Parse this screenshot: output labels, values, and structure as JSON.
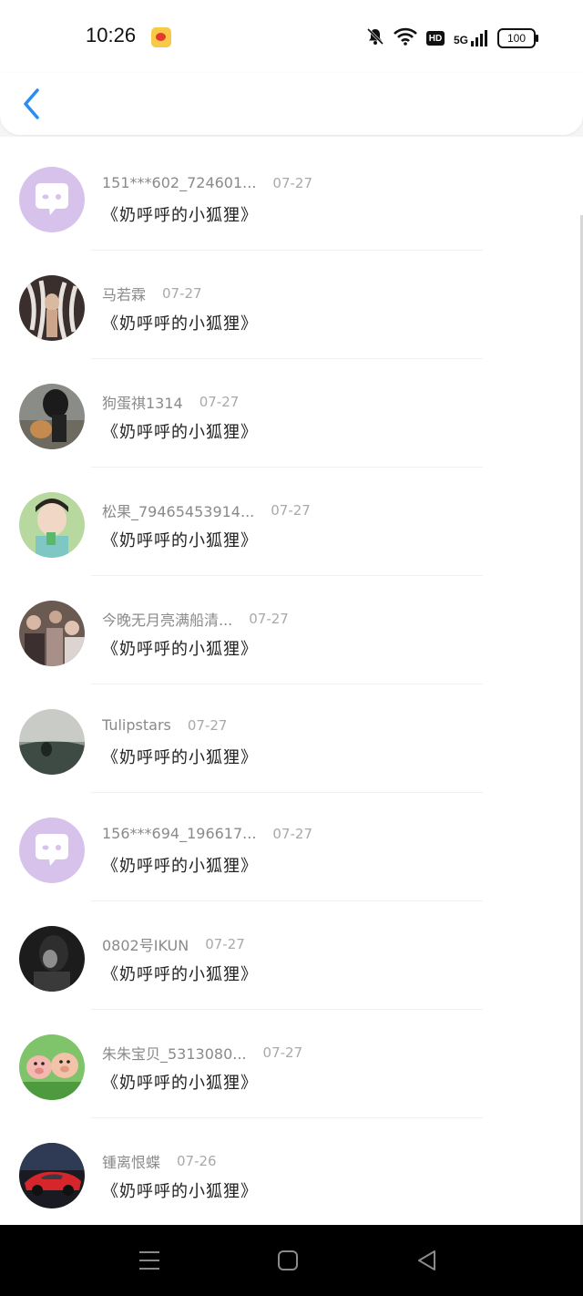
{
  "status_bar": {
    "time": "10:26",
    "battery": "100",
    "network_label": "5G",
    "hd_label": "HD"
  },
  "header": {
    "back_icon": "chevron-left-icon",
    "accent": "#2a8df2"
  },
  "entries": [
    {
      "name": "151***602_724601...",
      "date": "07-27",
      "message": "《奶呼呼的小狐狸》",
      "avatar": "placeholder"
    },
    {
      "name": "马若霖",
      "date": "07-27",
      "message": "《奶呼呼的小狐狸》",
      "avatar": "photo"
    },
    {
      "name": "狗蛋祺1314",
      "date": "07-27",
      "message": "《奶呼呼的小狐狸》",
      "avatar": "photo"
    },
    {
      "name": "松果_79465453914...",
      "date": "07-27",
      "message": "《奶呼呼的小狐狸》",
      "avatar": "photo"
    },
    {
      "name": "今晚无月亮满船清...",
      "date": "07-27",
      "message": "《奶呼呼的小狐狸》",
      "avatar": "photo"
    },
    {
      "name": "Tulipstars",
      "date": "07-27",
      "message": "《奶呼呼的小狐狸》",
      "avatar": "photo"
    },
    {
      "name": "156***694_196617...",
      "date": "07-27",
      "message": "《奶呼呼的小狐狸》",
      "avatar": "placeholder"
    },
    {
      "name": "0802号IKUN",
      "date": "07-27",
      "message": "《奶呼呼的小狐狸》",
      "avatar": "photo"
    },
    {
      "name": "朱朱宝贝_5313080...",
      "date": "07-27",
      "message": "《奶呼呼的小狐狸》",
      "avatar": "photo"
    },
    {
      "name": "锺离恨蝶",
      "date": "07-26",
      "message": "《奶呼呼的小狐狸》",
      "avatar": "photo"
    }
  ],
  "nav": {
    "menu_icon": "menu-icon",
    "home_icon": "home-square-icon",
    "back_icon": "back-triangle-icon"
  }
}
